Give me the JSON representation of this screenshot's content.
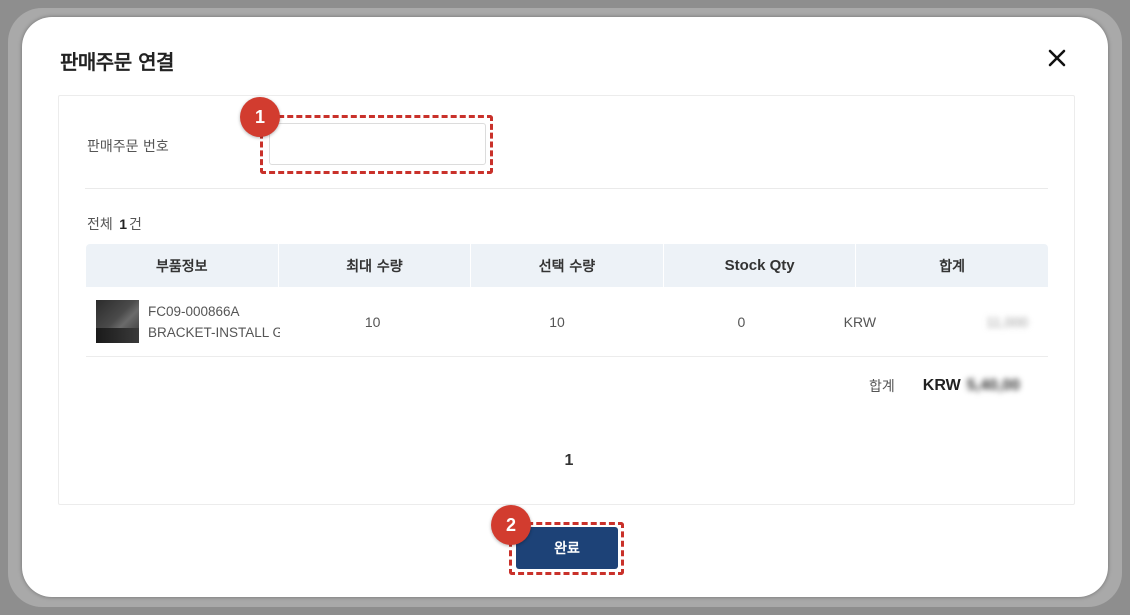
{
  "modal": {
    "title": "판매주문 연결",
    "close_icon": "close-icon"
  },
  "search": {
    "label": "판매주문 번호",
    "value": "",
    "placeholder": ""
  },
  "summary": {
    "prefix": "전체",
    "count": "1",
    "suffix": "건"
  },
  "table": {
    "headers": [
      "부품정보",
      "최대 수량",
      "선택 수량",
      "Stock Qty",
      "합계"
    ],
    "rows": [
      {
        "part_code": "FC09-000866A",
        "part_name": "BRACKET-INSTALL GU",
        "max_qty": "10",
        "selected_qty": "10",
        "stock_qty": "0",
        "currency": "KRW",
        "amount": "11,000"
      }
    ]
  },
  "total": {
    "label": "합계",
    "currency": "KRW",
    "amount": "5,40,00"
  },
  "pagination": {
    "current": "1"
  },
  "actions": {
    "done_label": "완료"
  },
  "annotations": {
    "step1": "1",
    "step2": "2"
  },
  "colors": {
    "primary_button": "#1d4277",
    "annotation_red": "#d23c2f",
    "table_header_bg": "#edf2f7"
  }
}
